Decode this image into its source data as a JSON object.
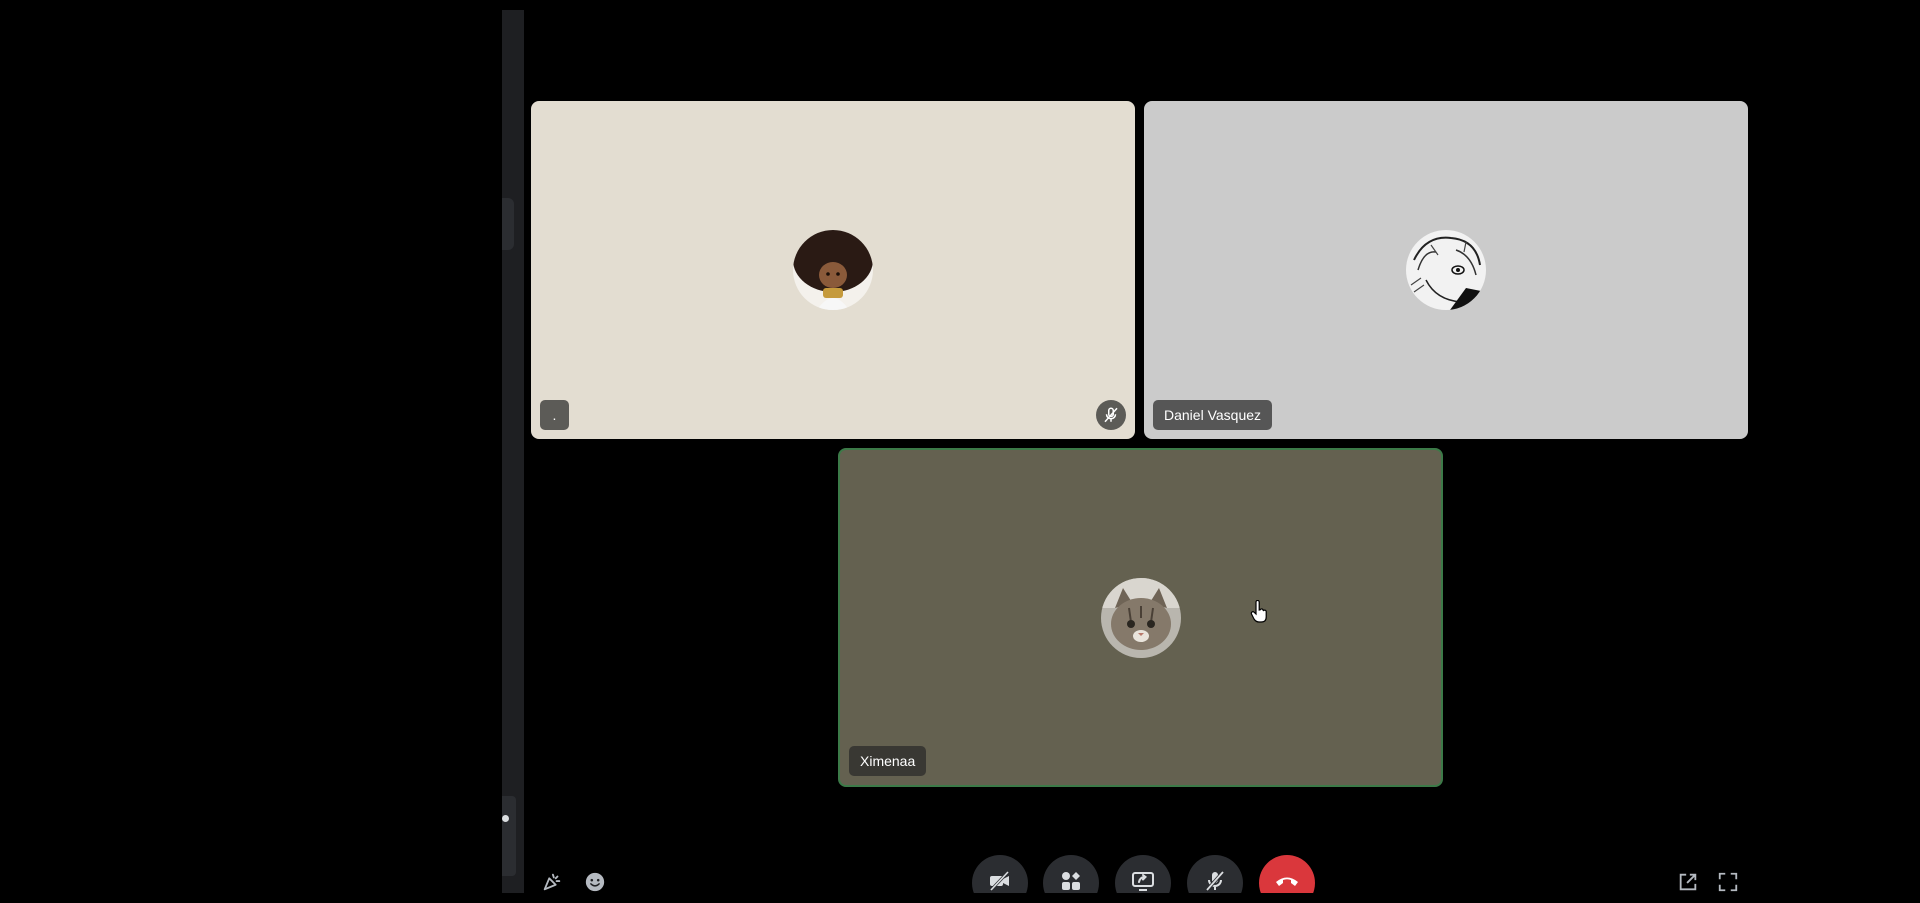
{
  "participants": [
    {
      "name": ".",
      "muted": true,
      "tile_color": "#e3ddd1",
      "avatar": "doll-avatar"
    },
    {
      "name": "Daniel Vasquez",
      "muted": false,
      "tile_color": "#cbcbcb",
      "avatar": "manga-sketch-avatar"
    },
    {
      "name": "Ximenaa",
      "muted": false,
      "tile_color": "#646150",
      "avatar": "cat-avatar",
      "speaking": true
    }
  ],
  "controls": {
    "left": [
      "activities-icon",
      "emoji-reaction-icon"
    ],
    "center": [
      "camera-off-icon",
      "apps-icon",
      "screen-share-icon",
      "microphone-muted-icon",
      "end-call-icon"
    ],
    "right": [
      "popout-icon",
      "fullscreen-icon"
    ]
  },
  "colors": {
    "background": "#000000",
    "speaking_border": "#3c7a48",
    "end_call": "#da373c",
    "control_bg": "#2b2d31"
  }
}
